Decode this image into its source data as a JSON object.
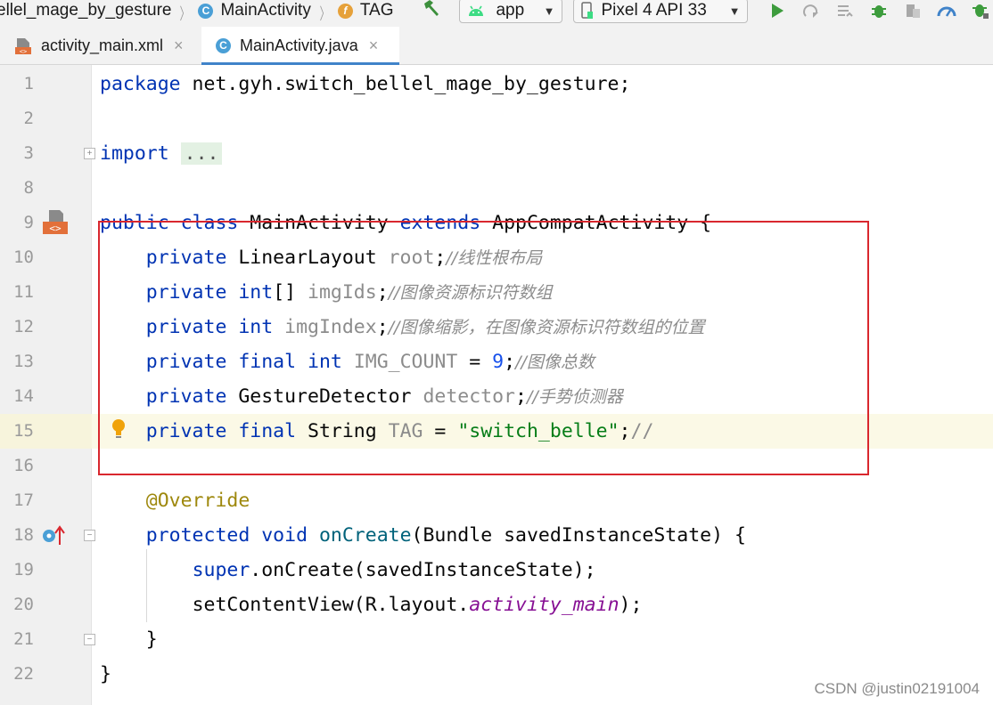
{
  "navbar": {
    "breadcrumbs": [
      {
        "label": "ellel_mage_by_gesture",
        "icon": "none"
      },
      {
        "label": "MainActivity",
        "icon": "class-icon"
      },
      {
        "label": "TAG",
        "icon": "field-icon"
      }
    ],
    "class_badge": "C",
    "field_badge": "f",
    "run_config": "app",
    "device": "Pixel 4 API 33"
  },
  "tabs": [
    {
      "label": "activity_main.xml",
      "active": false
    },
    {
      "label": "MainActivity.java",
      "active": true
    }
  ],
  "editor": {
    "caret_line": 15,
    "lines": [
      {
        "num": "1"
      },
      {
        "num": "2"
      },
      {
        "num": "3"
      },
      {
        "num": "8"
      },
      {
        "num": "9"
      },
      {
        "num": "10"
      },
      {
        "num": "11"
      },
      {
        "num": "12"
      },
      {
        "num": "13"
      },
      {
        "num": "14"
      },
      {
        "num": "15"
      },
      {
        "num": "16"
      },
      {
        "num": "17"
      },
      {
        "num": "18"
      },
      {
        "num": "19"
      },
      {
        "num": "20"
      },
      {
        "num": "21"
      },
      {
        "num": "22"
      }
    ],
    "code": {
      "l1_package": "package",
      "l1_name": " net.gyh.switch_bellel_mage_by_gesture;",
      "l3_import": "import",
      "l3_dots": "...",
      "l9_public": "public",
      "l9_class": "class",
      "l9_name": " MainActivity ",
      "l9_extends": "extends",
      "l9_rest": " AppCompatActivity {",
      "l10_mod": "private",
      "l10_type": " LinearLayout ",
      "l10_field": "root",
      "l10_semi": ";",
      "l10_comment": "//线性根布局",
      "l11_mod": "private",
      "l11_type": "int",
      "l11_br": "[] ",
      "l11_field": "imgIds",
      "l11_semi": ";",
      "l11_comment": "//图像资源标识符数组",
      "l12_mod": "private",
      "l12_type": "int",
      "l12_field": "imgIndex",
      "l12_semi": ";",
      "l12_comment": "//图像缩影，在图像资源标识符数组的位置",
      "l13_mod": "private",
      "l13_final": "final",
      "l13_type": "int",
      "l13_field": "IMG_COUNT",
      "l13_eq": " = ",
      "l13_num": "9",
      "l13_semi": ";",
      "l13_comment": "//图像总数",
      "l14_mod": "private",
      "l14_type": " GestureDetector ",
      "l14_field": "detector",
      "l14_semi": ";",
      "l14_comment": "//手势侦测器",
      "l15_mod": "private",
      "l15_final": "final",
      "l15_type": " String ",
      "l15_field": "TAG",
      "l15_eq": " = ",
      "l15_str": "\"switch_belle\"",
      "l15_semi": ";",
      "l15_comment": "//",
      "l17_ann": "@Override",
      "l18_mod": "protected",
      "l18_void": "void",
      "l18_method": "onCreate",
      "l18_rest": "(Bundle savedInstanceState) {",
      "l19_super": "super",
      "l19_rest": ".onCreate(savedInstanceState);",
      "l20_call": "setContentView(R.layout.",
      "l20_field": "activity_main",
      "l20_end": ");",
      "l21_brace": "}",
      "l22_brace": "}"
    }
  },
  "watermark": "CSDN @justin02191004",
  "colors": {
    "keyword": "#0033b3",
    "string": "#067d17",
    "number": "#1750eb",
    "comment": "#8c8c8c",
    "annotation": "#9e880d",
    "field": "#871094",
    "highlight_box": "#d9272e",
    "active_tab_underline": "#4083c9"
  }
}
